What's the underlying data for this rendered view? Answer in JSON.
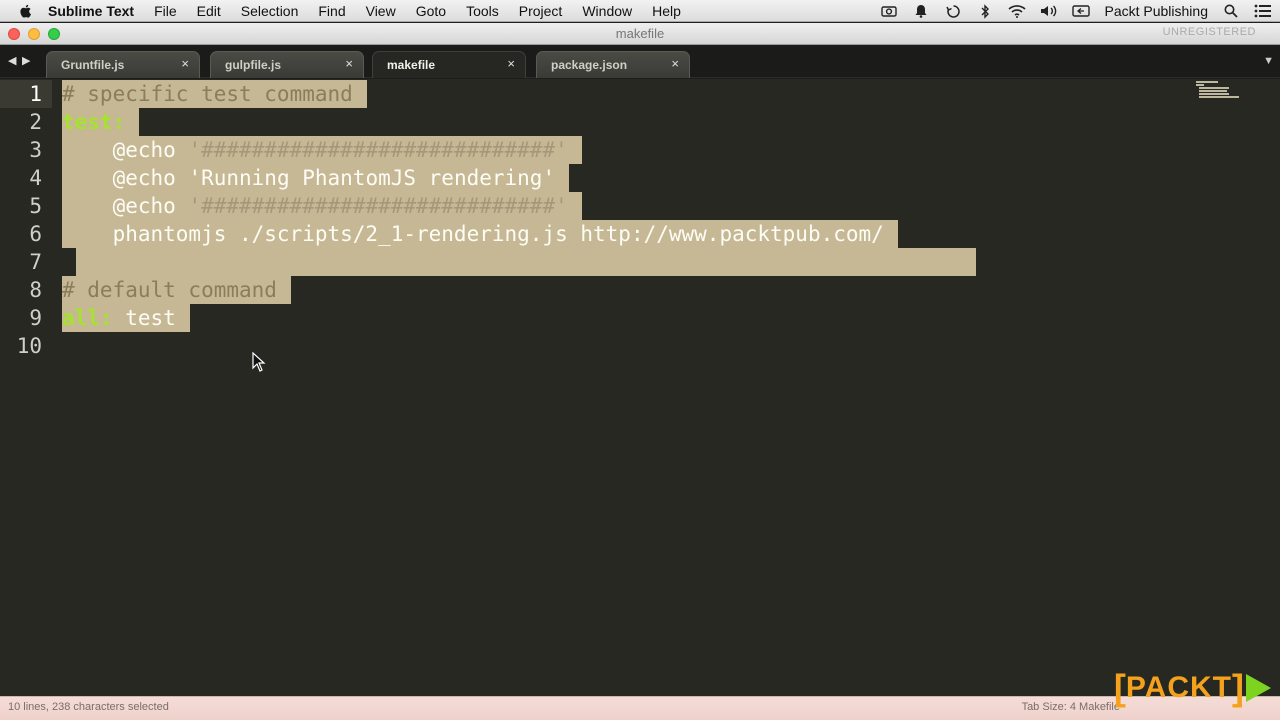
{
  "menubar": {
    "app_name": "Sublime Text",
    "items": [
      "File",
      "Edit",
      "Selection",
      "Find",
      "View",
      "Goto",
      "Tools",
      "Project",
      "Window",
      "Help"
    ],
    "user": "Packt Publishing"
  },
  "window": {
    "title": "makefile",
    "unregistered": "UNREGISTERED"
  },
  "tabs": [
    {
      "label": "Gruntfile.js",
      "active": false
    },
    {
      "label": "gulpfile.js",
      "active": false
    },
    {
      "label": "makefile",
      "active": true
    },
    {
      "label": "package.json",
      "active": false
    }
  ],
  "editor": {
    "current_line": 1,
    "line_numbers": [
      "1",
      "2",
      "3",
      "4",
      "5",
      "6",
      "7",
      "8",
      "9",
      "10"
    ],
    "lines": [
      "# specific test command",
      "test:",
      "    @echo '############################'",
      "    @echo 'Running PhantomJS rendering'",
      "    @echo '############################'",
      "    phantomjs ./scripts/2_1-rendering.js http://www.packtpub.com/",
      "",
      "# default command",
      "all: test",
      ""
    ]
  },
  "statusbar": {
    "left": "10 lines, 238 characters selected",
    "right": "Tab Size: 4    Makefile"
  },
  "logo": {
    "text": "PACKT"
  },
  "colors": {
    "editor_bg": "#272822",
    "selection": "#c6b894",
    "target_green": "#a6e22e",
    "comment": "#8c7d5a",
    "logo_orange": "#f4a21d",
    "logo_green": "#7ed321"
  }
}
